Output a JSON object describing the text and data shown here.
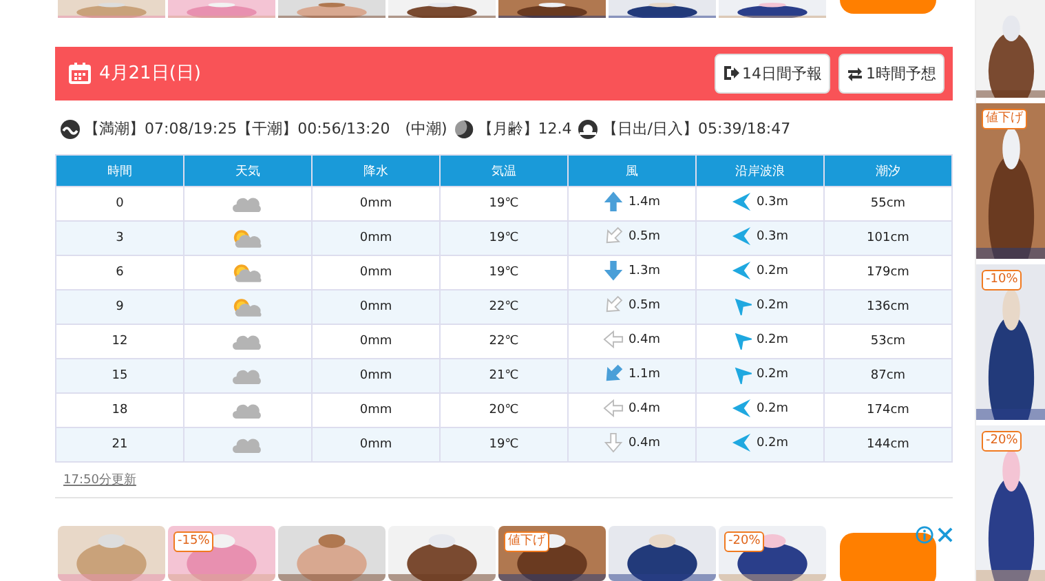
{
  "top_ads": [
    {
      "kind": "picture"
    },
    {
      "kind": "picture"
    },
    {
      "kind": "picture"
    },
    {
      "kind": "picture"
    },
    {
      "kind": "picture"
    },
    {
      "kind": "picture"
    },
    {
      "kind": "picture"
    }
  ],
  "header": {
    "date": "4月21日(日)",
    "buttons": [
      {
        "label": "14日間予報",
        "kind": "forecast"
      },
      {
        "label": "1時間予想",
        "kind": "hourly"
      }
    ]
  },
  "tide_info": [
    {
      "kind": "tide",
      "text": "【満潮】07:08/19:25【干潮】00:56/13:20　(中潮)"
    },
    {
      "kind": "moon",
      "text": "【月齢】12.4"
    },
    {
      "kind": "sun",
      "text": "【日出/日入】05:39/18:47"
    }
  ],
  "table": {
    "columns": [
      "時間",
      "天気",
      "降水",
      "気温",
      "風",
      "沿岸波浪",
      "潮汐"
    ],
    "rows": [
      {
        "time": "0",
        "weather": {
          "kind": "cloudy"
        },
        "rain": "0mm",
        "temp": "19℃",
        "wind_arrow": {
          "kind": "north",
          "strong": true
        },
        "wind": "1.4m",
        "wave_arrow": {
          "kind": "west"
        },
        "wave": "0.3m",
        "tide": "55cm"
      },
      {
        "time": "3",
        "weather": {
          "kind": "suncloud"
        },
        "rain": "0mm",
        "temp": "19℃",
        "wind_arrow": {
          "kind": "southwest",
          "strong": false
        },
        "wind": "0.5m",
        "wave_arrow": {
          "kind": "west"
        },
        "wave": "0.3m",
        "tide": "101cm"
      },
      {
        "time": "6",
        "weather": {
          "kind": "suncloud"
        },
        "rain": "0mm",
        "temp": "19℃",
        "wind_arrow": {
          "kind": "south",
          "strong": true
        },
        "wind": "1.3m",
        "wave_arrow": {
          "kind": "west"
        },
        "wave": "0.2m",
        "tide": "179cm"
      },
      {
        "time": "9",
        "weather": {
          "kind": "suncloud"
        },
        "rain": "0mm",
        "temp": "22℃",
        "wind_arrow": {
          "kind": "southwest",
          "strong": false
        },
        "wind": "0.5m",
        "wave_arrow": {
          "kind": "southwest"
        },
        "wave": "0.2m",
        "tide": "136cm"
      },
      {
        "time": "12",
        "weather": {
          "kind": "cloudy"
        },
        "rain": "0mm",
        "temp": "22℃",
        "wind_arrow": {
          "kind": "west",
          "strong": false
        },
        "wind": "0.4m",
        "wave_arrow": {
          "kind": "southwest"
        },
        "wave": "0.2m",
        "tide": "53cm"
      },
      {
        "time": "15",
        "weather": {
          "kind": "cloudy"
        },
        "rain": "0mm",
        "temp": "21℃",
        "wind_arrow": {
          "kind": "southwest",
          "strong": true
        },
        "wind": "1.1m",
        "wave_arrow": {
          "kind": "southwest"
        },
        "wave": "0.2m",
        "tide": "87cm"
      },
      {
        "time": "18",
        "weather": {
          "kind": "cloudy"
        },
        "rain": "0mm",
        "temp": "20℃",
        "wind_arrow": {
          "kind": "west",
          "strong": false
        },
        "wind": "0.4m",
        "wave_arrow": {
          "kind": "west"
        },
        "wave": "0.2m",
        "tide": "174cm"
      },
      {
        "time": "21",
        "weather": {
          "kind": "cloudy"
        },
        "rain": "0mm",
        "temp": "19℃",
        "wind_arrow": {
          "kind": "south",
          "strong": false
        },
        "wind": "0.4m",
        "wave_arrow": {
          "kind": "west"
        },
        "wave": "0.2m",
        "tide": "144cm"
      }
    ]
  },
  "updated": "17:50分更新",
  "bottom_ads": [
    {
      "kind": "picture"
    },
    {
      "kind": "picture",
      "badge": "-15%"
    },
    {
      "kind": "picture"
    },
    {
      "kind": "picture"
    },
    {
      "kind": "picture",
      "badge": "値下げ"
    },
    {
      "kind": "picture"
    },
    {
      "kind": "picture",
      "badge": "-20%"
    }
  ],
  "side_ads": [
    {
      "kind": "picture"
    },
    {
      "kind": "picture",
      "badge": "値下げ"
    },
    {
      "kind": "picture",
      "badge": "-10%"
    },
    {
      "kind": "picture",
      "badge": "-20%"
    }
  ]
}
